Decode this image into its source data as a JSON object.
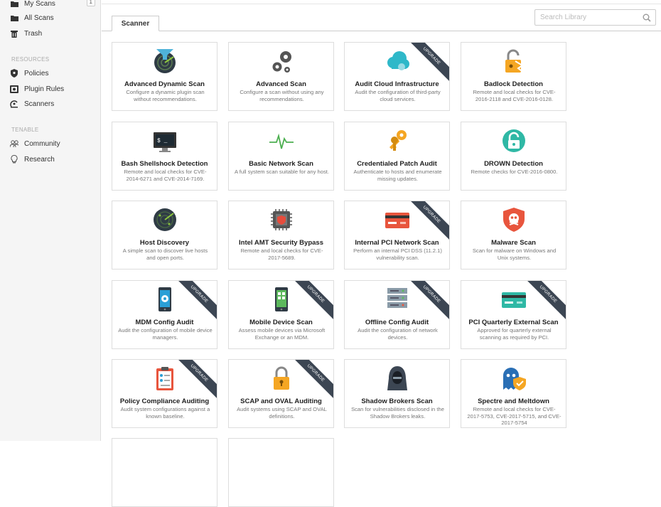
{
  "sidebar": {
    "items": [
      {
        "label": "My Scans",
        "icon": "folder-icon",
        "badge": "1"
      },
      {
        "label": "All Scans",
        "icon": "folder-icon"
      },
      {
        "label": "Trash",
        "icon": "trash-icon"
      }
    ],
    "resources_heading": "RESOURCES",
    "resources": [
      {
        "label": "Policies",
        "icon": "shield-icon"
      },
      {
        "label": "Plugin Rules",
        "icon": "plugin-icon"
      },
      {
        "label": "Scanners",
        "icon": "scanner-icon"
      }
    ],
    "tenable_heading": "TENABLE",
    "tenable": [
      {
        "label": "Community",
        "icon": "community-icon"
      },
      {
        "label": "Research",
        "icon": "lightbulb-icon"
      }
    ]
  },
  "search": {
    "placeholder": "Search Library"
  },
  "tab": {
    "label": "Scanner"
  },
  "ribbon_label": "UPGRADE",
  "cards": [
    {
      "title": "Advanced Dynamic Scan",
      "desc": "Configure a dynamic plugin scan without recommendations.",
      "icon": "radar-filter-icon",
      "upgrade": false
    },
    {
      "title": "Advanced Scan",
      "desc": "Configure a scan without using any recommendations.",
      "icon": "gears-icon",
      "upgrade": false
    },
    {
      "title": "Audit Cloud Infrastructure",
      "desc": "Audit the configuration of third-party cloud services.",
      "icon": "cloud-icon",
      "upgrade": true
    },
    {
      "title": "Badlock Detection",
      "desc": "Remote and local checks for CVE-2016-2118 and CVE-2016-0128.",
      "icon": "broken-lock-icon",
      "upgrade": false
    },
    {
      "title": "Bash Shellshock Detection",
      "desc": "Remote and local checks for CVE-2014-6271 and CVE-2014-7169.",
      "icon": "terminal-icon",
      "upgrade": false
    },
    {
      "title": "Basic Network Scan",
      "desc": "A full system scan suitable for any host.",
      "icon": "pulse-icon",
      "upgrade": false
    },
    {
      "title": "Credentialed Patch Audit",
      "desc": "Authenticate to hosts and enumerate missing updates.",
      "icon": "keys-icon",
      "upgrade": false
    },
    {
      "title": "DROWN Detection",
      "desc": "Remote checks for CVE-2016-0800.",
      "icon": "drown-lock-icon",
      "upgrade": false
    },
    {
      "title": "Host Discovery",
      "desc": "A simple scan to discover live hosts and open ports.",
      "icon": "radar-icon",
      "upgrade": false
    },
    {
      "title": "Intel AMT Security Bypass",
      "desc": "Remote and local checks for CVE-2017-5689.",
      "icon": "chip-icon",
      "upgrade": false
    },
    {
      "title": "Internal PCI Network Scan",
      "desc": "Perform an internal PCI DSS (11.2.1) vulnerability scan.",
      "icon": "credit-card-icon",
      "upgrade": true
    },
    {
      "title": "Malware Scan",
      "desc": "Scan for malware on Windows and Unix systems.",
      "icon": "malware-shield-icon",
      "upgrade": false
    },
    {
      "title": "MDM Config Audit",
      "desc": "Audit the configuration of mobile device managers.",
      "icon": "mobile-gear-icon",
      "upgrade": true
    },
    {
      "title": "Mobile Device Scan",
      "desc": "Assess mobile devices via Microsoft Exchange or an MDM.",
      "icon": "smartphone-icon",
      "upgrade": true
    },
    {
      "title": "Offline Config Audit",
      "desc": "Audit the configuration of network devices.",
      "icon": "server-icon",
      "upgrade": true
    },
    {
      "title": "PCI Quarterly External Scan",
      "desc": "Approved for quarterly external scanning as required by PCI.",
      "icon": "green-card-icon",
      "upgrade": true
    },
    {
      "title": "Policy Compliance Auditing",
      "desc": "Audit system configurations against a known baseline.",
      "icon": "clipboard-icon",
      "upgrade": true
    },
    {
      "title": "SCAP and OVAL Auditing",
      "desc": "Audit systems using SCAP and OVAL definitions.",
      "icon": "padlock-icon",
      "upgrade": true
    },
    {
      "title": "Shadow Brokers Scan",
      "desc": "Scan for vulnerabilities disclosed in the Shadow Brokers leaks.",
      "icon": "hooded-figure-icon",
      "upgrade": false
    },
    {
      "title": "Spectre and Meltdown",
      "desc": "Remote and local checks for CVE-2017-5753, CVE-2017-5715, and CVE-2017-5754",
      "icon": "ghost-shield-icon",
      "upgrade": false
    }
  ]
}
